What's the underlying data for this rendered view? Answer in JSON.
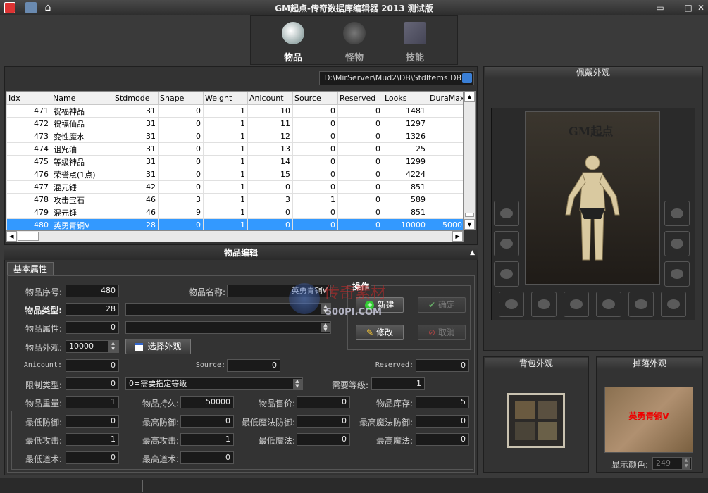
{
  "window": {
    "title": "GM起点-传奇数据库编辑器 2013 测试版"
  },
  "nav": [
    {
      "label": "物品",
      "active": true
    },
    {
      "label": "怪物",
      "active": false
    },
    {
      "label": "技能",
      "active": false
    }
  ],
  "db_path": "D:\\MirServer\\Mud2\\DB\\StdItems.DB",
  "table": {
    "columns": [
      "Idx",
      "Name",
      "Stdmode",
      "Shape",
      "Weight",
      "Anicount",
      "Source",
      "Reserved",
      "Looks",
      "DuraMax"
    ],
    "rows": [
      [
        "471",
        "祝福神品",
        "31",
        "0",
        "1",
        "10",
        "0",
        "0",
        "1481",
        ""
      ],
      [
        "472",
        "祝福仙品",
        "31",
        "0",
        "1",
        "11",
        "0",
        "0",
        "1297",
        ""
      ],
      [
        "473",
        "变性魔水",
        "31",
        "0",
        "1",
        "12",
        "0",
        "0",
        "1326",
        ""
      ],
      [
        "474",
        "诅咒油",
        "31",
        "0",
        "1",
        "13",
        "0",
        "0",
        "25",
        ""
      ],
      [
        "475",
        "等级神品",
        "31",
        "0",
        "1",
        "14",
        "0",
        "0",
        "1299",
        ""
      ],
      [
        "476",
        "荣誉点(1点)",
        "31",
        "0",
        "1",
        "15",
        "0",
        "0",
        "4224",
        ""
      ],
      [
        "477",
        "混元锤",
        "42",
        "0",
        "1",
        "0",
        "0",
        "0",
        "851",
        ""
      ],
      [
        "478",
        "攻击宝石",
        "46",
        "3",
        "1",
        "3",
        "1",
        "0",
        "589",
        ""
      ],
      [
        "479",
        "混元锤",
        "46",
        "9",
        "1",
        "0",
        "0",
        "0",
        "851",
        ""
      ],
      [
        "480",
        "英勇青铜Ⅴ",
        "28",
        "0",
        "1",
        "0",
        "0",
        "0",
        "10000",
        "5000"
      ]
    ]
  },
  "editor": {
    "heading": "物品编辑",
    "tab": "基本属性",
    "item_no_label": "物品序号:",
    "item_no": "480",
    "item_name_label": "物品名称:",
    "item_name": "英勇青铜Ⅴ",
    "item_type_label": "物品类型:",
    "item_type": "28",
    "item_type_desc": "",
    "item_attr_label": "物品属性:",
    "item_attr": "0",
    "item_attr_desc": "",
    "item_look_label": "物品外观:",
    "item_look": "10000",
    "choose_look": "选择外观",
    "anicount_label": "Anicount:",
    "anicount": "0",
    "source_label": "Source:",
    "source": "0",
    "reserved_label": "Reserved:",
    "reserved": "0",
    "limit_type_label": "限制类型:",
    "limit_type": "0",
    "limit_type_desc": "0=需要指定等级",
    "need_level_label": "需要等级:",
    "need_level": "1",
    "weight_label": "物品重量:",
    "weight": "1",
    "dura_label": "物品持久:",
    "dura": "50000",
    "price_label": "物品售价:",
    "price": "0",
    "stock_label": "物品库存:",
    "stock": "5",
    "min_def_label": "最低防御:",
    "min_def": "0",
    "max_def_label": "最高防御:",
    "max_def": "0",
    "min_mdef_label": "最低魔法防御:",
    "min_mdef": "0",
    "max_mdef_label": "最高魔法防御:",
    "max_mdef": "0",
    "min_atk_label": "最低攻击:",
    "min_atk": "1",
    "max_atk_label": "最高攻击:",
    "max_atk": "1",
    "min_mag_label": "最低魔法:",
    "min_mag": "0",
    "max_mag_label": "最高魔法:",
    "max_mag": "0",
    "min_tao_label": "最低道术:",
    "min_tao": "0",
    "max_tao_label": "最高道术:",
    "max_tao": "0"
  },
  "ops": {
    "title": "操作",
    "new": "新建",
    "ok": "确定",
    "modify": "修改",
    "cancel": "取消"
  },
  "right": {
    "equip_title": "佩戴外观",
    "equip_logo": "GM起点",
    "bag_title": "背包外观",
    "drop_title": "掉落外观",
    "drop_name": "英勇青铜Ⅴ",
    "color_label": "显示颜色:",
    "color_value": "249"
  },
  "watermark": {
    "text": "传奇素材",
    "url": "500PI.COM"
  }
}
